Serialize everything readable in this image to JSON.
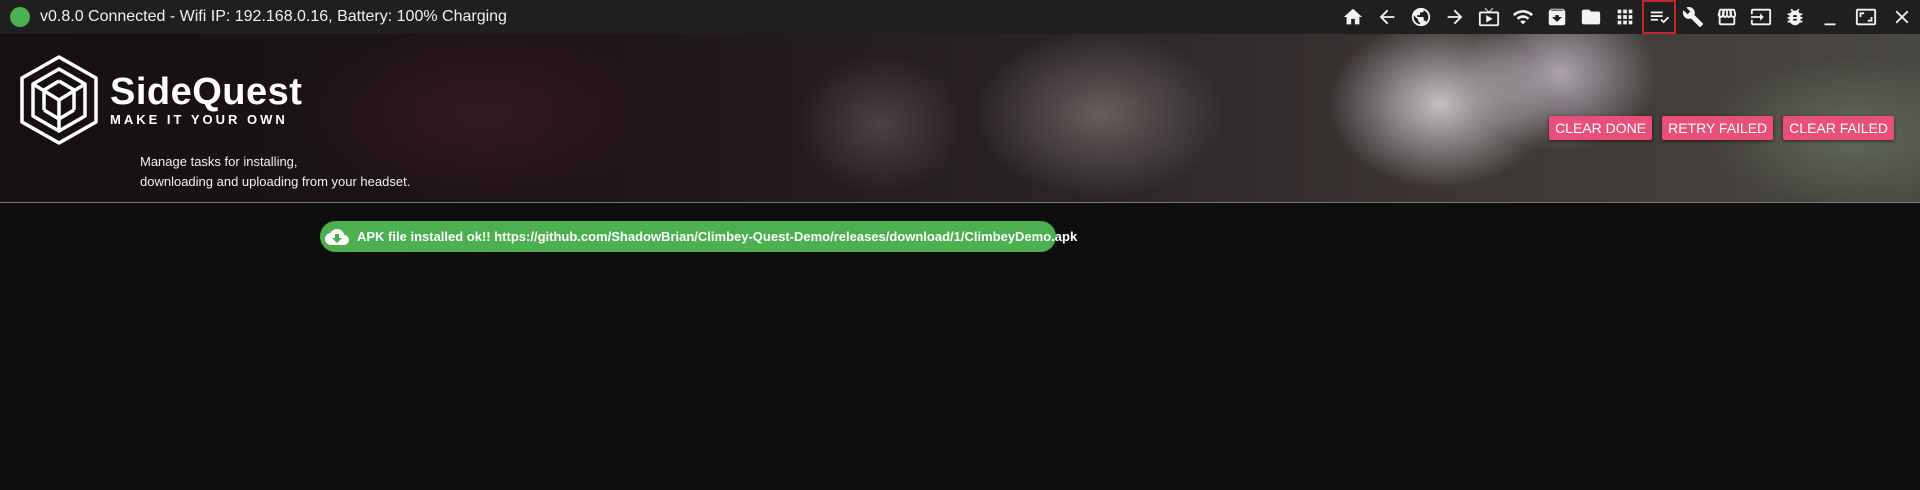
{
  "status": {
    "text": "v0.8.0  Connected - Wifi IP: 192.168.0.16, Battery: 100% Charging",
    "dot_color": "#4caf50"
  },
  "toolbar": {
    "icons": [
      "home-icon",
      "back-arrow-icon",
      "globe-icon",
      "forward-arrow-icon",
      "tv-play-icon",
      "wifi-icon",
      "archive-download-icon",
      "folder-icon",
      "apps-grid-icon",
      "task-list-icon",
      "wrench-icon",
      "storefront-icon",
      "exit-icon",
      "bug-icon",
      "minimize-icon",
      "maximize-icon",
      "close-icon"
    ],
    "active": "task-list-icon"
  },
  "banner": {
    "logo_name": "SideQuest",
    "logo_tagline": "MAKE IT YOUR OWN",
    "description_line1": "Manage tasks for installing,",
    "description_line2": "downloading and uploading from your headset."
  },
  "actions": {
    "clear_done": "CLEAR DONE",
    "retry_failed": "RETRY FAILED",
    "clear_failed": "CLEAR FAILED",
    "color": "#e8507a"
  },
  "tasks": [
    {
      "icon": "cloud-download-icon",
      "text": "APK file installed ok!! https://github.com/ShadowBrian/Climbey-Quest-Demo/releases/download/1/ClimbeyDemo.apk",
      "color": "#4caf50"
    }
  ]
}
